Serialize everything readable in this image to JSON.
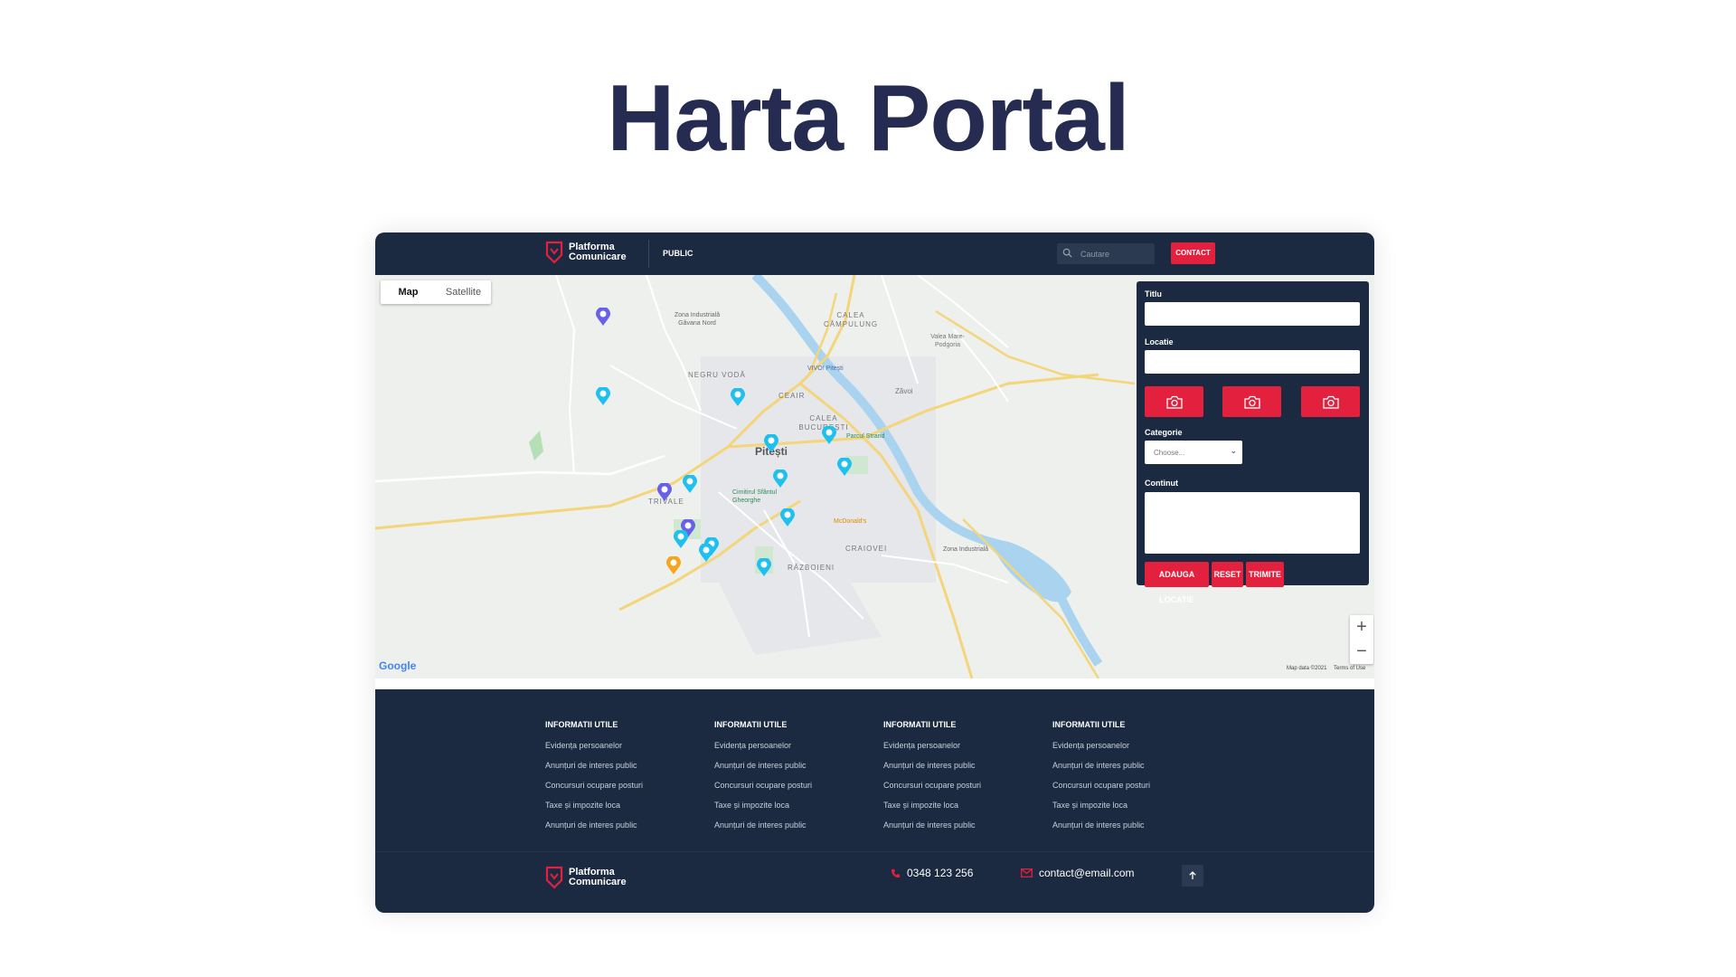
{
  "title": "Harta Portal",
  "header": {
    "brand_line1": "Platforma",
    "brand_line2": "Comunicare",
    "nav_public": "PUBLIC",
    "search_placeholder": "Cautare",
    "contact_label": "CONTACT"
  },
  "map": {
    "type_options": [
      "Map",
      "Satellite"
    ],
    "selected_type": "Map",
    "zoom_in": "+",
    "zoom_out": "−",
    "provider": "Google",
    "map_data": "Map data ©2021",
    "terms": "Terms of Use",
    "places": [
      "Zona Industrială Găvana Nord",
      "NEGRU VODĂ",
      "CALEA CÂMPULUNG",
      "Valea Mare-Podgoria",
      "Zăvoi",
      "CEAIR",
      "VIVO! Pitești",
      "CALEA BUCUREȘTI",
      "Pitești",
      "Parcul Ștrand",
      "Cimitirul Sfântul Gheorghe",
      "TRIVALE",
      "McDonald's",
      "CRAIOVEI",
      "Zona Industrială",
      "RĂZBOIENI"
    ]
  },
  "form": {
    "title_label": "Titlu",
    "location_label": "Locatie",
    "category_label": "Categorie",
    "category_selected": "Choose...",
    "content_label": "Continut",
    "add_location": "ADAUGA LOCATIE",
    "reset": "RESET",
    "submit": "TRIMITE"
  },
  "footer": {
    "columns": [
      {
        "heading": "INFORMATII UTILE",
        "links": [
          "Evidența persoanelor",
          "Anunțuri de interes public",
          "Concursuri ocupare posturi",
          "Taxe și impozite loca",
          "Anunțuri de interes public"
        ]
      },
      {
        "heading": "INFORMATII UTILE",
        "links": [
          "Evidența persoanelor",
          "Anunțuri de interes public",
          "Concursuri ocupare posturi",
          "Taxe și impozite loca",
          "Anunțuri de interes public"
        ]
      },
      {
        "heading": "INFORMATII UTILE",
        "links": [
          "Evidența persoanelor",
          "Anunțuri de interes public",
          "Concursuri ocupare posturi",
          "Taxe și impozite loca",
          "Anunțuri de interes public"
        ]
      },
      {
        "heading": "INFORMATII UTILE",
        "links": [
          "Evidența persoanelor",
          "Anunțuri de interes public",
          "Concursuri ocupare posturi",
          "Taxe și impozite loca",
          "Anunțuri de interes public"
        ]
      }
    ],
    "brand_line1": "Platforma",
    "brand_line2": "Comunicare",
    "phone": "0348 123 256",
    "email": "contact@email.com"
  },
  "colors": {
    "navy": "#1b2a40",
    "accent_red": "#e3203d",
    "title_color": "#262b52",
    "pin_cyan": "#1ec0f0",
    "pin_purple": "#6860e8",
    "pin_orange": "#f6a51d"
  }
}
